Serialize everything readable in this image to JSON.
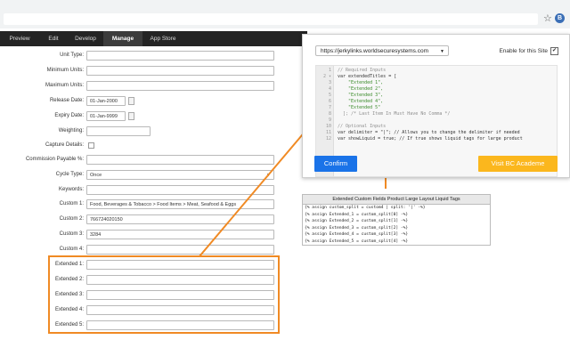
{
  "browser": {
    "star_glyph": "☆",
    "ext_glyph": "B",
    "icons": [
      "star-icon",
      "extension-icon"
    ]
  },
  "nav": {
    "tabs": [
      {
        "label": "Preview",
        "active": false
      },
      {
        "label": "Edit",
        "active": false
      },
      {
        "label": "Develop",
        "active": false
      },
      {
        "label": "Manage",
        "active": true
      },
      {
        "label": "App Store",
        "active": false
      }
    ]
  },
  "form": {
    "fields": [
      {
        "label": "Unit Type:",
        "value": ""
      },
      {
        "label": "Minimum Units:",
        "value": ""
      },
      {
        "label": "Maximum Units:",
        "value": ""
      },
      {
        "label": "Release Date:",
        "value": "01-Jan-2000"
      },
      {
        "label": "Expiry Date:",
        "value": "01-Jan-9999"
      },
      {
        "label": "Weighting:",
        "value": ""
      },
      {
        "label": "Capture Details:",
        "value": ""
      },
      {
        "label": "Commission Payable %:",
        "value": ""
      },
      {
        "label": "Cycle Type:",
        "value": "Once"
      },
      {
        "label": "Keywords:",
        "value": ""
      },
      {
        "label": "Custom 1:",
        "value": "Food, Beverages & Tobacco > Food Items > Meat, Seafood & Eggs"
      },
      {
        "label": "Custom 2:",
        "value": "766724020150"
      },
      {
        "label": "Custom 3:",
        "value": "3284"
      },
      {
        "label": "Custom 4:",
        "value": ""
      },
      {
        "label": "Extended 1:",
        "value": ""
      },
      {
        "label": "Extended 2:",
        "value": ""
      },
      {
        "label": "Extended 3:",
        "value": ""
      },
      {
        "label": "Extended 4:",
        "value": ""
      },
      {
        "label": "Extended 5:",
        "value": ""
      }
    ]
  },
  "popup": {
    "site_url": "https://jerkylinks.worldsecuresystems.com",
    "enable_label": "Enable for this Site",
    "enable_checked": "✔",
    "code_lines": [
      {
        "n": "1",
        "text": "// Required Inputs"
      },
      {
        "n": "2 ▾",
        "text": "var extendedTitles = ["
      },
      {
        "n": "3",
        "text": "    \"Extended 1\","
      },
      {
        "n": "4",
        "text": "    \"Extended 2\","
      },
      {
        "n": "5",
        "text": "    \"Extended 3\","
      },
      {
        "n": "6",
        "text": "    \"Extended 4\","
      },
      {
        "n": "7",
        "text": "    \"Extended 5\""
      },
      {
        "n": "8",
        "text": "  ]; /* Last Item In Must Have No Comma */"
      },
      {
        "n": "9",
        "text": ""
      },
      {
        "n": "10",
        "text": "// Optional Inputs"
      },
      {
        "n": "11",
        "text": "var delimiter = \"|\"; // Allows you to change the delimiter if needed"
      },
      {
        "n": "12",
        "text": "var showLiquid = true; // If true shows liquid tags for large product"
      }
    ],
    "confirm_label": "Confirm",
    "visit_label": "Visit BC Academe"
  },
  "liquid": {
    "title": "Extended Custom Fields Product Large Layout Liquid Tags",
    "lines": [
      "{% assign custom_split = custom4 | split: '|' -%}",
      "{% assign Extended_1 = custom_split[0] -%}",
      "{% assign Extended_2 = custom_split[1] -%}",
      "{% assign Extended_3 = custom_split[2] -%}",
      "{% assign Extended_4 = custom_split[3] -%}",
      "{% assign Extended_5 = custom_split[4] -%}"
    ]
  },
  "colors": {
    "accent_orange": "#f08a24",
    "confirm_blue": "#1a73e8",
    "visit_yellow": "#fbb71d",
    "nav_dark": "#242424"
  }
}
